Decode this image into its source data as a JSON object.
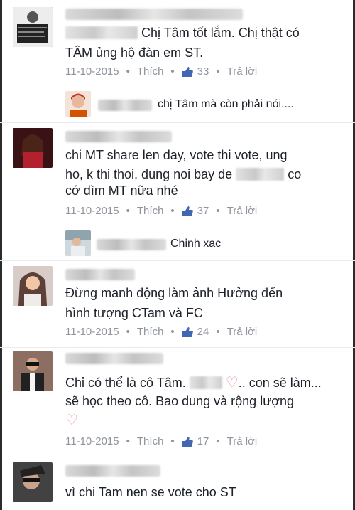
{
  "comments": [
    {
      "line1": "Chị Tâm tốt lắm. Chị thật có",
      "line2": "TÂM ủng hộ đàn em ST.",
      "date": "11-10-2015",
      "like_label": "Thích",
      "likes": "33",
      "reply_label": "Trả lời"
    },
    {
      "text": "chị Tâm mà còn phải nói...."
    },
    {
      "line1": "chi  MT share len day, vote thi vote, ung",
      "line2_prefix": "ho, k thi thoi, dung noi bay de",
      "line2_suffix": "co",
      "line3": "cớ dìm MT nữa nhé",
      "date": "11-10-2015",
      "like_label": "Thích",
      "likes": "37",
      "reply_label": "Trả lời"
    },
    {
      "text": "Chinh xac"
    },
    {
      "line1": "Đừng manh động làm ảnh Hưởng đến",
      "line2": "hình tượng CTam và FC",
      "date": "11-10-2015",
      "like_label": "Thích",
      "likes": "24",
      "reply_label": "Trả lời"
    },
    {
      "line1_a": "Chỉ có thể là cô Tâm.",
      "line1_b": ".. con sẽ làm...",
      "line2": "sẽ học theo cô. Bao dung và rộng lượng",
      "date": "11-10-2015",
      "like_label": "Thích",
      "likes": "17",
      "reply_label": "Trả lời"
    },
    {
      "text": "vì chi Tam nen se vote cho ST"
    }
  ],
  "colors": {
    "text": "#1d2129",
    "meta": "#90949c",
    "like_blue": "#4267b2",
    "heart": "#f08c9c"
  },
  "icons": [
    "like-thumb-icon",
    "heart-icon"
  ]
}
